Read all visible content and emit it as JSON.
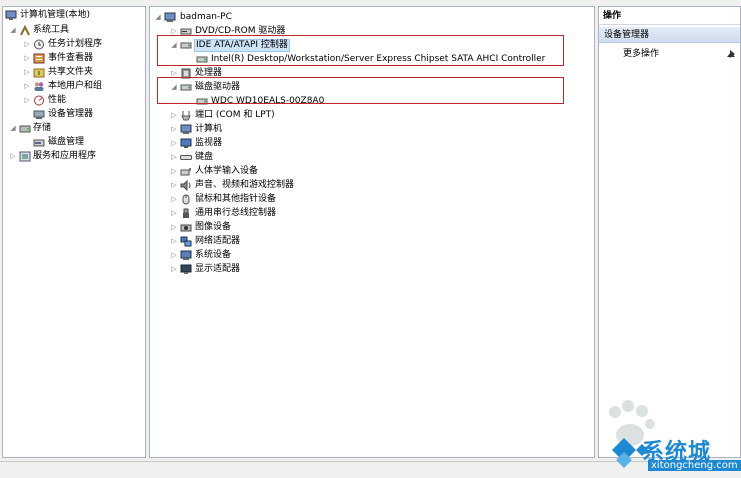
{
  "left_tree": {
    "root": "计算机管理(本地)",
    "system_tools": "系统工具",
    "task_scheduler": "任务计划程序",
    "event_viewer": "事件查看器",
    "shared_folders": "共享文件夹",
    "local_users": "本地用户和组",
    "performance": "性能",
    "device_manager": "设备管理器",
    "storage": "存储",
    "disk_management": "磁盘管理",
    "services_apps": "服务和应用程序"
  },
  "device_tree": {
    "computer": "badman-PC",
    "dvd": "DVD/CD-ROM 驱动器",
    "ide": "IDE ATA/ATAPI 控制器",
    "ide_child": "Intel(R) Desktop/Workstation/Server Express Chipset SATA AHCI Controller",
    "processor": "处理器",
    "disk_drives": "磁盘驱动器",
    "disk_child": "WDC WD10EALS-00Z8A0",
    "ports": "端口 (COM 和 LPT)",
    "computer_node": "计算机",
    "monitors": "监视器",
    "keyboards": "键盘",
    "hid": "人体学输入设备",
    "sound": "声音、视频和游戏控制器",
    "mice": "鼠标和其他指针设备",
    "usb": "通用串行总线控制器",
    "imaging": "图像设备",
    "network": "网络适配器",
    "system_devices": "系统设备",
    "display": "显示适配器"
  },
  "actions": {
    "header": "操作",
    "section": "设备管理器",
    "more": "更多操作"
  },
  "watermark": {
    "brand": "系统城",
    "url": "xitongcheng.com"
  },
  "colors": {
    "highlight_box": "#c0262c",
    "selection": "#cce4f7"
  }
}
